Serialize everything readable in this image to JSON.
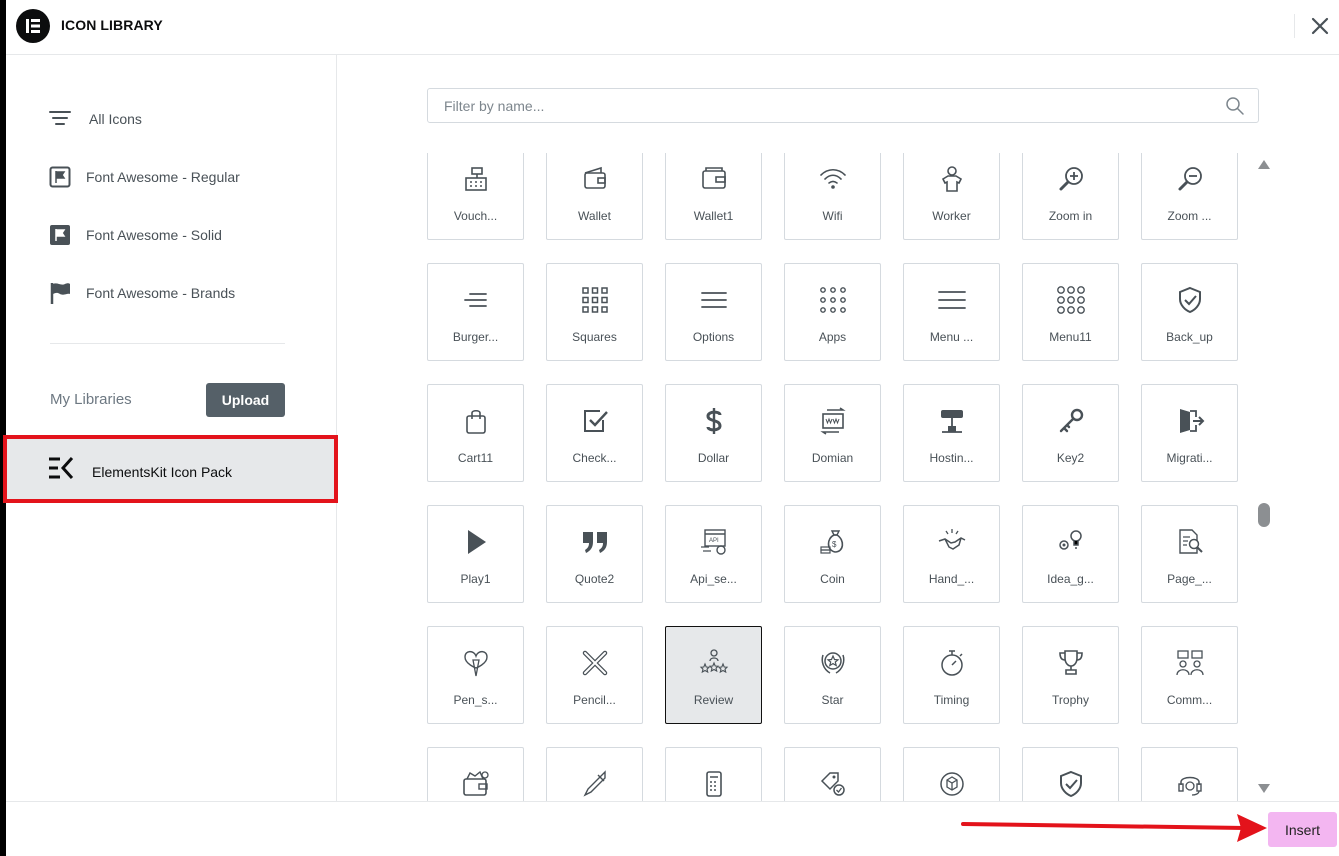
{
  "header": {
    "title": "ICON LIBRARY"
  },
  "sidebar": {
    "items": [
      {
        "label": "All Icons",
        "icon": "filter-lines-icon"
      },
      {
        "label": "Font Awesome - Regular",
        "icon": "flag-regular-icon"
      },
      {
        "label": "Font Awesome - Solid",
        "icon": "flag-solid-icon"
      },
      {
        "label": "Font Awesome - Brands",
        "icon": "flag-brands-icon"
      }
    ],
    "my_libraries_label": "My Libraries",
    "upload_label": "Upload",
    "elementskit_label": "ElementsKit Icon Pack"
  },
  "search": {
    "placeholder": "Filter by name..."
  },
  "icons": [
    "Vouch...",
    "Wallet",
    "Wallet1",
    "Wifi",
    "Worker",
    "Zoom in",
    "Zoom ...",
    "Burger...",
    "Squares",
    "Options",
    "Apps",
    "Menu ...",
    "Menu11",
    "Back_up",
    "Cart11",
    "Check...",
    "Dollar",
    "Domian",
    "Hostin...",
    "Key2",
    "Migrati...",
    "Play1",
    "Quote2",
    "Api_se...",
    "Coin",
    "Hand_...",
    "Idea_g...",
    "Page_...",
    "Pen_s...",
    "Pencil...",
    "Review",
    "Star",
    "Timing",
    "Trophy",
    "Comm...",
    "",
    "",
    "",
    "",
    "",
    "",
    ""
  ],
  "selected_icon": "Review",
  "footer": {
    "insert_label": "Insert"
  },
  "colors": {
    "highlight": "#e3131b",
    "insert_bg": "#f3b6f1",
    "upload_bg": "#556068"
  }
}
